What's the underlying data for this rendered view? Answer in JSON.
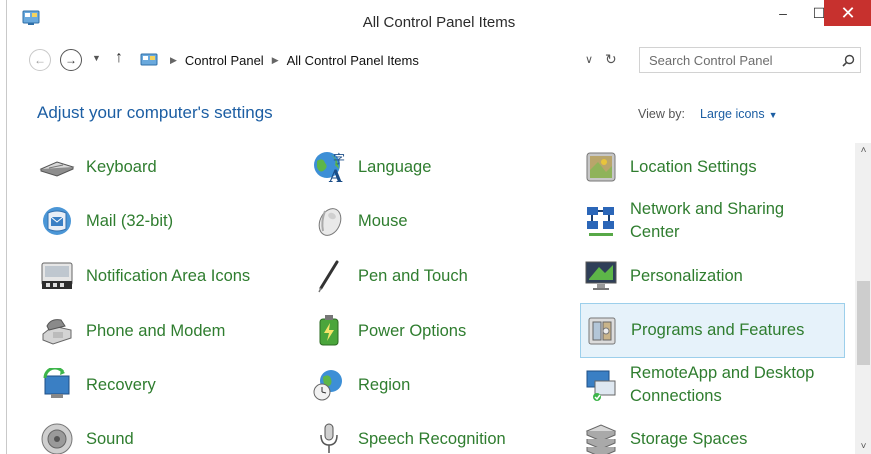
{
  "window": {
    "title": "All Control Panel Items",
    "minimize_glyph": "–",
    "maximize_glyph": "☐",
    "close_glyph": "✕"
  },
  "nav": {
    "back_glyph": "←",
    "forward_glyph": "→",
    "recent_glyph": "▼",
    "up_glyph": "↑",
    "breadcrumb": [
      "Control Panel",
      "All Control Panel Items"
    ],
    "breadcrumb_sep": "▶",
    "address_dropdown_glyph": "∨",
    "refresh_glyph": "↻",
    "search_placeholder": "Search Control Panel"
  },
  "content": {
    "heading": "Adjust your computer's settings",
    "view_by_label": "View by:",
    "view_by_value": "Large icons",
    "view_by_caret": "▼"
  },
  "items": [
    {
      "label": "Keyboard",
      "icon": "keyboard-icon"
    },
    {
      "label": "Language",
      "icon": "language-icon"
    },
    {
      "label": "Location Settings",
      "icon": "location-icon"
    },
    {
      "label": "Mail (32-bit)",
      "icon": "mail-icon"
    },
    {
      "label": "Mouse",
      "icon": "mouse-icon"
    },
    {
      "label": "Network and Sharing Center",
      "icon": "network-icon"
    },
    {
      "label": "Notification Area Icons",
      "icon": "notification-icon"
    },
    {
      "label": "Pen and Touch",
      "icon": "pen-icon"
    },
    {
      "label": "Personalization",
      "icon": "personalization-icon"
    },
    {
      "label": "Phone and Modem",
      "icon": "phone-icon"
    },
    {
      "label": "Power Options",
      "icon": "power-icon"
    },
    {
      "label": "Programs and Features",
      "icon": "programs-icon",
      "selected": true
    },
    {
      "label": "Recovery",
      "icon": "recovery-icon"
    },
    {
      "label": "Region",
      "icon": "region-icon"
    },
    {
      "label": "RemoteApp and Desktop Connections",
      "icon": "remoteapp-icon"
    },
    {
      "label": "Sound",
      "icon": "sound-icon"
    },
    {
      "label": "Speech Recognition",
      "icon": "speech-icon"
    },
    {
      "label": "Storage Spaces",
      "icon": "storage-icon"
    }
  ],
  "scrollbar": {
    "up_glyph": "˄",
    "down_glyph": "˅"
  },
  "colors": {
    "link_green": "#2f7d2f",
    "heading_blue": "#1c5ea3",
    "close_red": "#c7312e",
    "selection_bg": "#e6f2fa"
  }
}
